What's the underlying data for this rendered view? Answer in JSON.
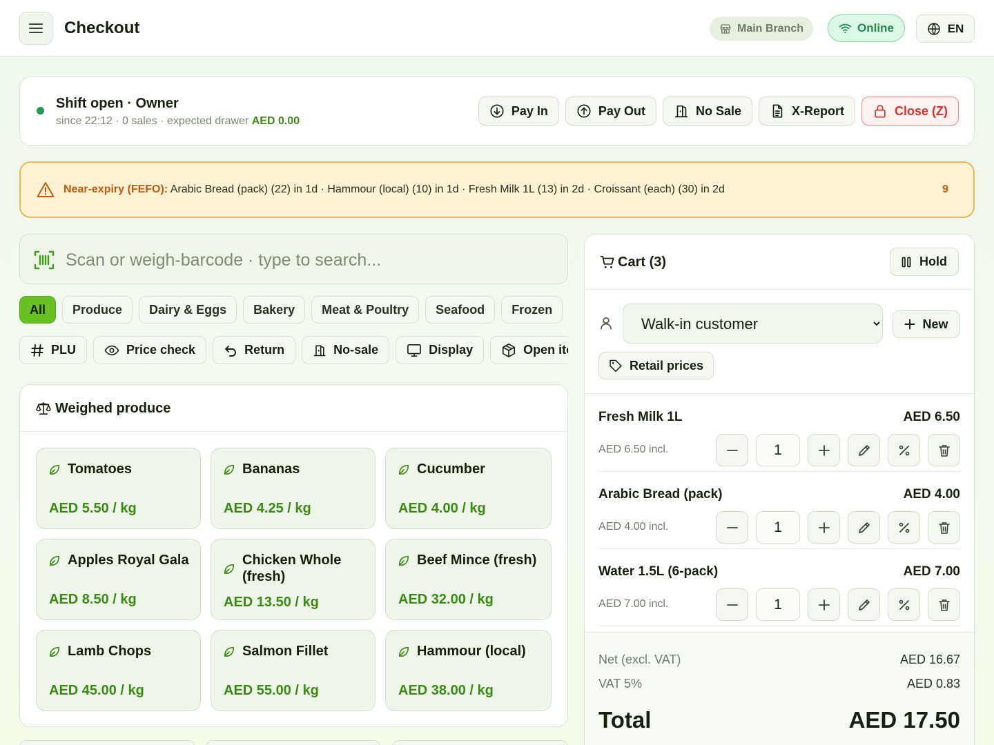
{
  "header": {
    "title": "Checkout",
    "branch": "Main Branch",
    "status": "Online",
    "language": "EN"
  },
  "shift": {
    "title": "Shift open · Owner",
    "subtitle": "since 22:12 · 0 sales · expected drawer",
    "drawer_amount": "AED 0.00",
    "actions": {
      "pay_in": "Pay In",
      "pay_out": "Pay Out",
      "no_sale": "No Sale",
      "x_report": "X-Report",
      "close": "Close (Z)"
    }
  },
  "expiry": {
    "label": "Near-expiry (FEFO):",
    "items": "Arabic Bread (pack) (22) in 1d · Hammour (local) (10) in 1d · Fresh Milk 1L (13) in 2d · Croissant (each) (30) in 2d",
    "count": "9"
  },
  "search": {
    "placeholder": "Scan or weigh-barcode · type to search..."
  },
  "categories": [
    "All",
    "Produce",
    "Dairy & Eggs",
    "Bakery",
    "Meat & Poultry",
    "Seafood",
    "Frozen"
  ],
  "tools": [
    "PLU",
    "Price check",
    "Return",
    "No-sale",
    "Display",
    "Open item"
  ],
  "produce": {
    "title": "Weighed produce",
    "items": [
      {
        "name": "Tomatoes",
        "price": "AED 5.50 / kg"
      },
      {
        "name": "Bananas",
        "price": "AED 4.25 / kg"
      },
      {
        "name": "Cucumber",
        "price": "AED 4.00 / kg"
      },
      {
        "name": "Apples Royal Gala",
        "price": "AED 8.50 / kg"
      },
      {
        "name": "Chicken Whole (fresh)",
        "price": "AED 13.50 / kg"
      },
      {
        "name": "Beef Mince (fresh)",
        "price": "AED 32.00 / kg"
      },
      {
        "name": "Lamb Chops",
        "price": "AED 45.00 / kg"
      },
      {
        "name": "Salmon Fillet",
        "price": "AED 55.00 / kg"
      },
      {
        "name": "Hammour (local)",
        "price": "AED 38.00 / kg"
      }
    ]
  },
  "cart": {
    "title": "Cart (3)",
    "hold": "Hold",
    "customer": "Walk-in customer",
    "new": "New",
    "price_list": "Retail prices",
    "lines": [
      {
        "name": "Fresh Milk 1L",
        "total": "AED 6.50",
        "unit": "AED 6.50 incl.",
        "qty": "1"
      },
      {
        "name": "Arabic Bread (pack)",
        "total": "AED 4.00",
        "unit": "AED 4.00 incl.",
        "qty": "1"
      },
      {
        "name": "Water 1.5L (6-pack)",
        "total": "AED 7.00",
        "unit": "AED 7.00 incl.",
        "qty": "1"
      }
    ],
    "net_label": "Net (excl. VAT)",
    "net_value": "AED 16.67",
    "vat_label": "VAT 5%",
    "vat_value": "AED 0.83",
    "total_label": "Total",
    "total_value": "AED 17.50"
  }
}
